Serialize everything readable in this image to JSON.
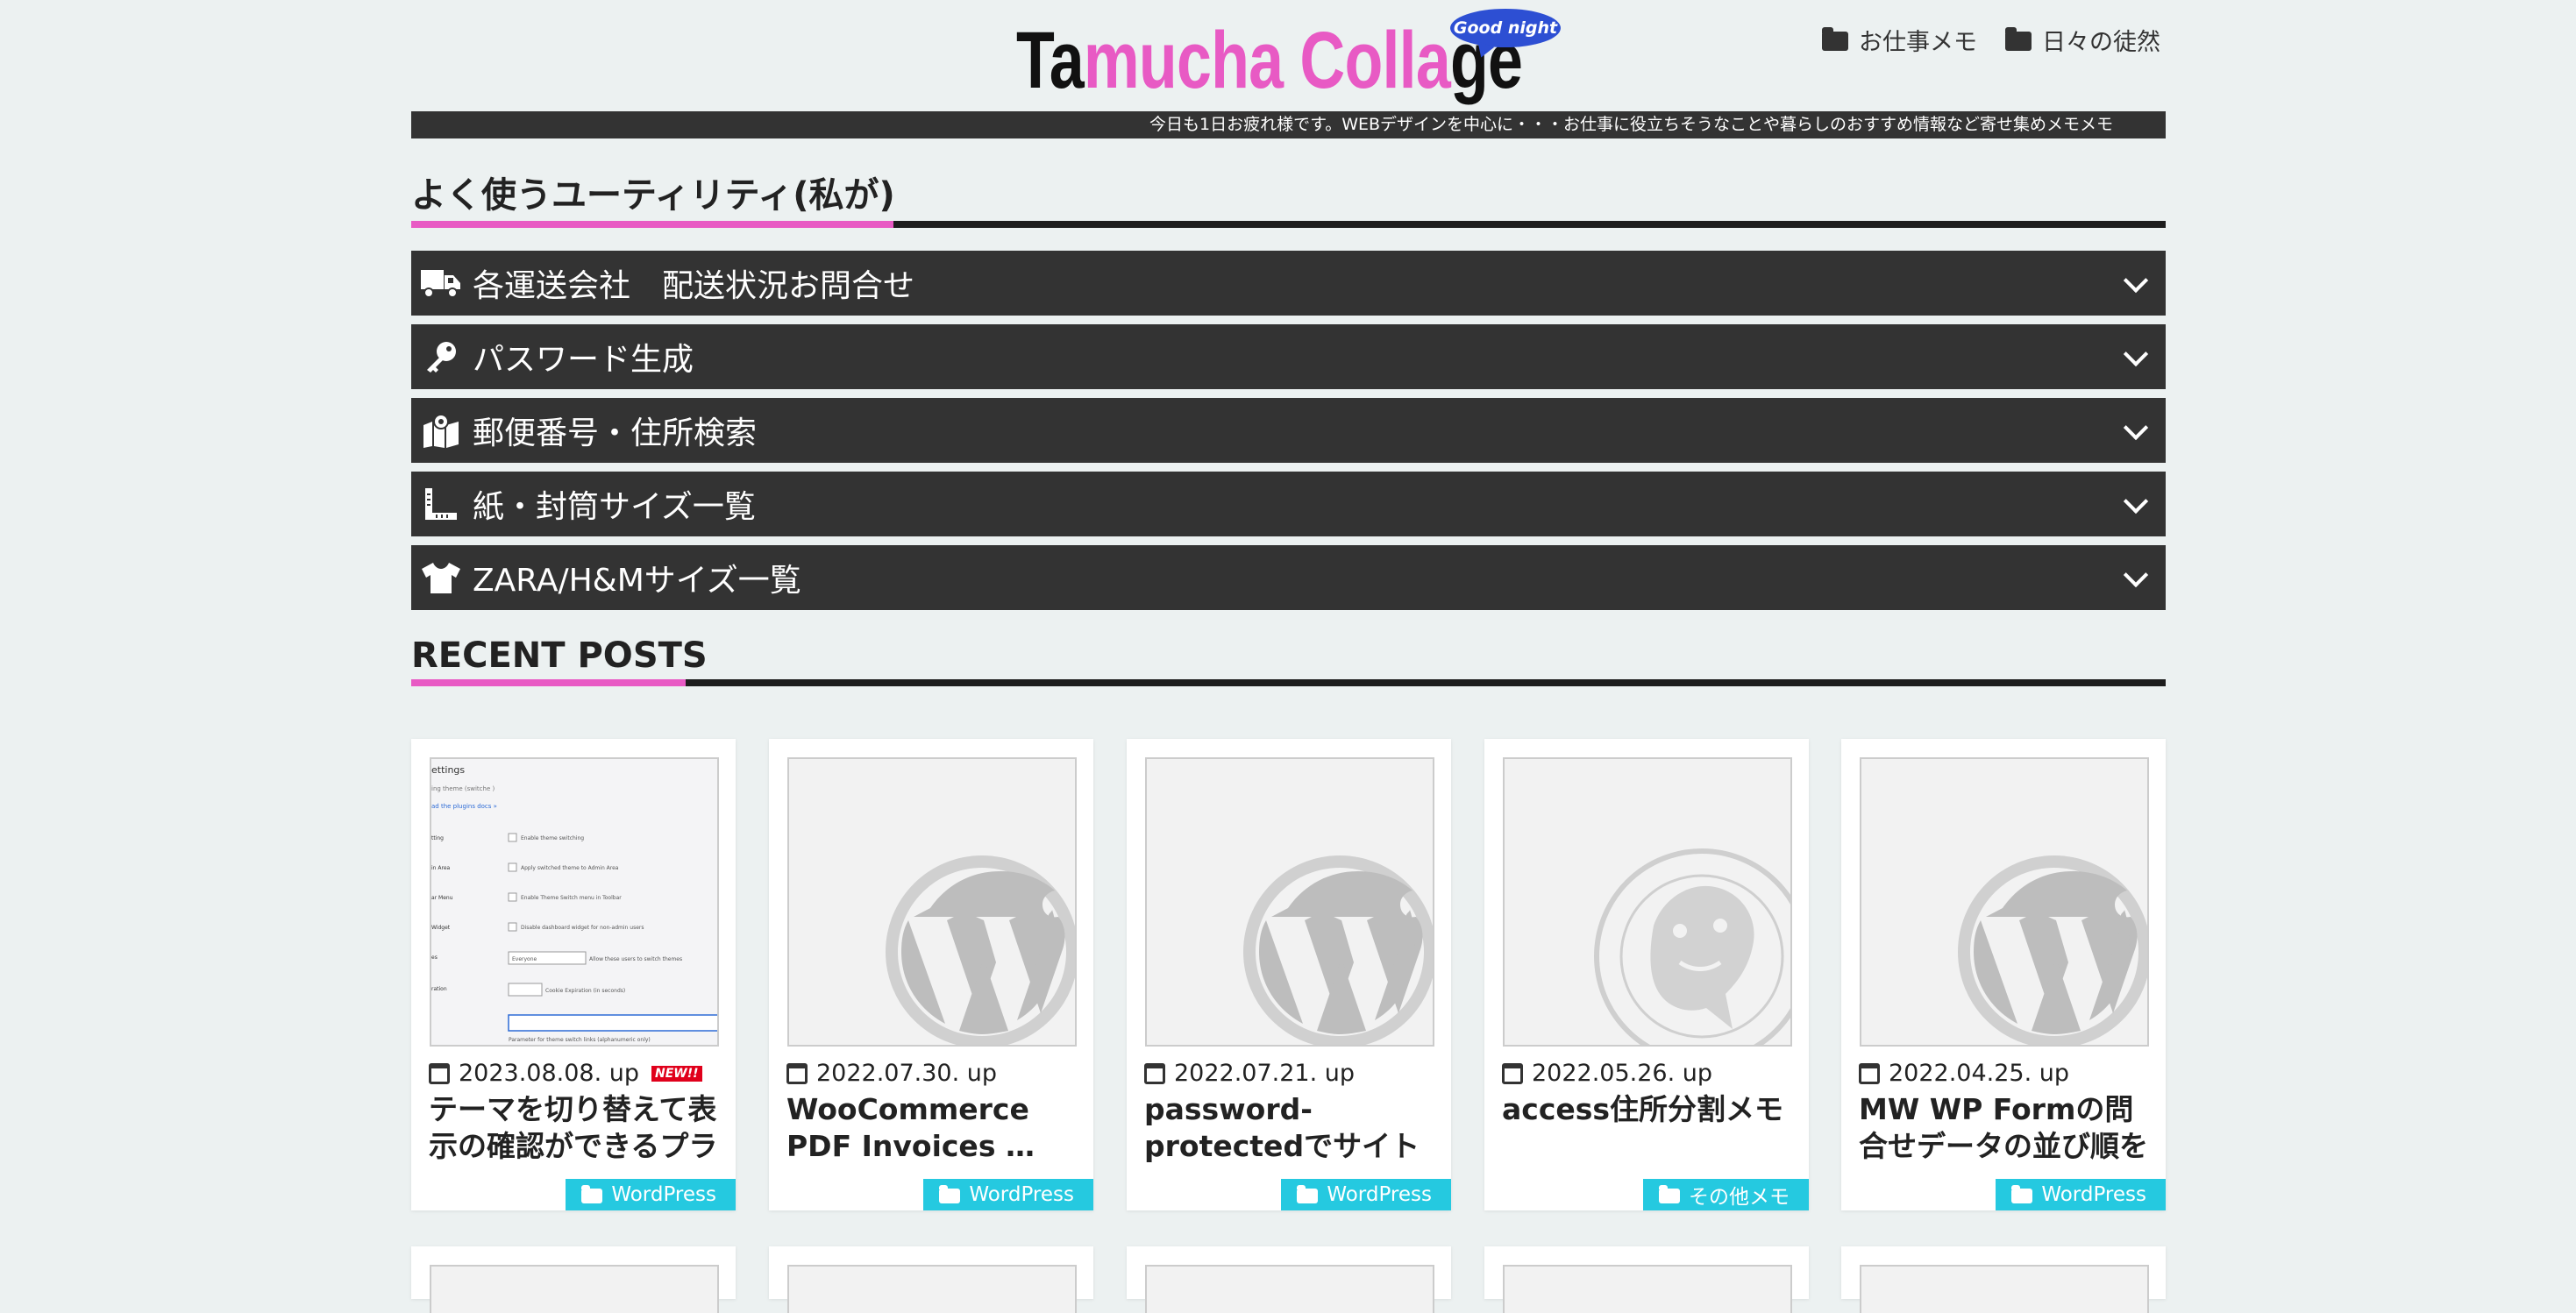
{
  "header": {
    "logo_part1": "Ta",
    "logo_part2": "mucha Colla",
    "logo_part3": "ge",
    "logo_badge": "Good night",
    "nav": [
      {
        "label": "お仕事メモ",
        "icon": "folder-icon"
      },
      {
        "label": "日々の徒然",
        "icon": "folder-icon"
      }
    ]
  },
  "ticker": "今日も1日お疲れ様です。WEBデザインを中心に・・・お仕事に役立ちそうなことや暮らしのおすすめ情報など寄せ集めメモメモ",
  "utilities": {
    "title": "よく使うユーティリティ(私が)",
    "items": [
      {
        "label": "各運送会社　配送状況お問合せ",
        "icon": "truck-icon"
      },
      {
        "label": "パスワード生成",
        "icon": "key-icon"
      },
      {
        "label": "郵便番号・住所検索",
        "icon": "map-pin-icon"
      },
      {
        "label": "紙・封筒サイズ一覧",
        "icon": "ruler-icon"
      },
      {
        "label": "ZARA/H&Mサイズ一覧",
        "icon": "tshirt-icon"
      }
    ]
  },
  "recent": {
    "title": "RECENT POSTS",
    "posts": [
      {
        "date": "2023.08.08. up",
        "new": "NEW!!",
        "title": "テーマを切り替えて表示の確認ができるプラ",
        "category": "WordPress",
        "thumb": "settings-screenshot"
      },
      {
        "date": "2022.07.30. up",
        "new": "",
        "title": "WooCommerce PDF Invoices …",
        "category": "WordPress",
        "thumb": "wordpress-logo"
      },
      {
        "date": "2022.07.21. up",
        "new": "",
        "title": "password-protectedでサイトトップ…",
        "category": "WordPress",
        "thumb": "wordpress-logo"
      },
      {
        "date": "2022.05.26. up",
        "new": "",
        "title": "access住所分割メモ",
        "category": "その他メモ",
        "thumb": "lion-seal"
      },
      {
        "date": "2022.04.25. up",
        "new": "",
        "title": "MW WP Formの問合せデータの並び順を項",
        "category": "WordPress",
        "thumb": "wordpress-logo"
      }
    ]
  },
  "colors": {
    "accent_pink": "#e85ac4",
    "category_cyan": "#25c9e0",
    "dark_bar": "#333333",
    "background": "#ecf1f1"
  }
}
